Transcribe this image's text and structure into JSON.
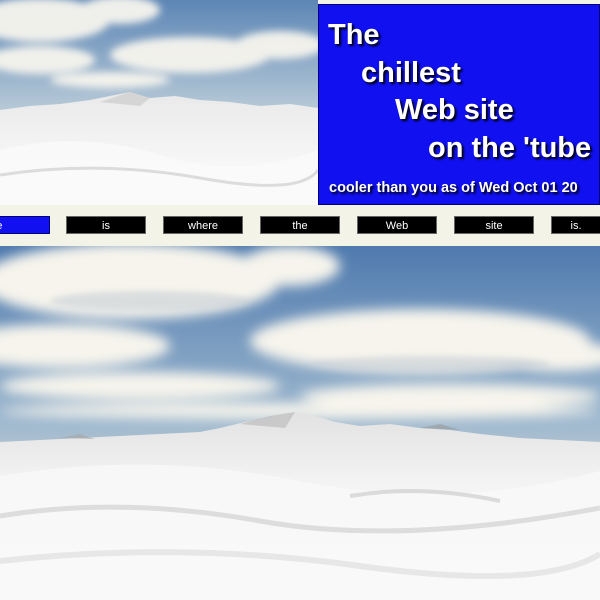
{
  "title": {
    "lines": [
      "The",
      "chillest",
      "Web site",
      "on the 'tube"
    ],
    "subtitle": "cooler than you as of Wed Oct 01 20"
  },
  "nav": {
    "items": [
      "Home",
      "is",
      "where",
      "the",
      "Web",
      "site",
      "is."
    ],
    "active_index": 0
  },
  "colors": {
    "panel_blue": "#1010f0",
    "nav_black": "#000000",
    "page_bg": "#f3f3e8"
  }
}
